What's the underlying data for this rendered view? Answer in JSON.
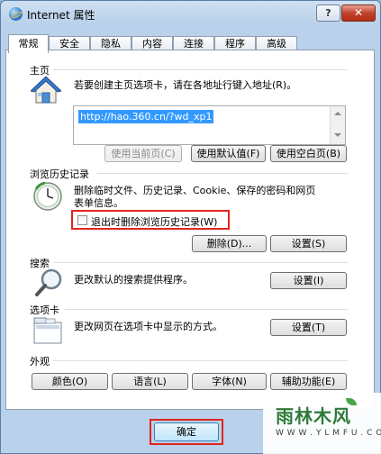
{
  "window": {
    "title": "Internet 属性",
    "help_label": "?",
    "close_label": "✕"
  },
  "tabs": [
    {
      "label": "常规",
      "active": true
    },
    {
      "label": "安全"
    },
    {
      "label": "隐私"
    },
    {
      "label": "内容"
    },
    {
      "label": "连接"
    },
    {
      "label": "程序"
    },
    {
      "label": "高级"
    }
  ],
  "home": {
    "section": "主页",
    "description": "若要创建主页选项卡，请在各地址行键入地址(R)。",
    "url": "http://hao.360.cn/?wd_xp1",
    "buttons": {
      "current": "使用当前页(C)",
      "default": "使用默认值(F)",
      "blank": "使用空白页(B)"
    }
  },
  "history": {
    "section": "浏览历史记录",
    "description_line1": "删除临时文件、历史记录、Cookie、保存的密码和网页",
    "description_line2": "表单信息。",
    "checkbox_label": "退出时删除浏览历史记录(W)",
    "checkbox_checked": false,
    "buttons": {
      "delete": "删除(D)...",
      "settings": "设置(S)"
    }
  },
  "search": {
    "section": "搜索",
    "description": "更改默认的搜索提供程序。",
    "settings": "设置(I)"
  },
  "tabs_section": {
    "section": "选项卡",
    "description": "更改网页在选项卡中显示的方式。",
    "settings": "设置(T)"
  },
  "appearance": {
    "section": "外观",
    "buttons": {
      "colors": "颜色(O)",
      "languages": "语言(L)",
      "fonts": "字体(N)",
      "accessibility": "辅助功能(E)"
    }
  },
  "footer": {
    "ok": "确定"
  },
  "watermark": {
    "text": "雨林木风",
    "url": "W W W . Y L M F U . C O M"
  }
}
